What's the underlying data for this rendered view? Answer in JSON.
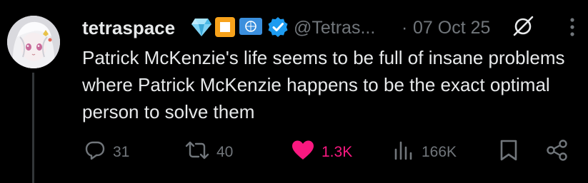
{
  "tweet": {
    "author": {
      "display_name": "tetraspace",
      "handle": "@Tetras...",
      "badges": [
        "gem-icon",
        "orange-square-icon",
        "un-flag-icon",
        "verified-icon"
      ]
    },
    "date": "07 Oct 25",
    "separator": "·",
    "text": "Patrick McKenzie's life seems to be full of insane problems where Patrick McKenzie happens to be the exact optimal person to solve them",
    "metrics": {
      "replies": "31",
      "reposts": "40",
      "likes": "1.3K",
      "views": "166K"
    },
    "liked": true
  },
  "colors": {
    "background": "#000000",
    "text": "#e7e9ea",
    "muted": "#71767b",
    "like": "#f91880",
    "verified": "#1d9bf0",
    "thread_line": "#333639"
  },
  "icons": {
    "grok": "slashed-circle-icon",
    "more": "more-vertical-icon",
    "reply": "reply-icon",
    "repost": "repost-icon",
    "like": "heart-icon",
    "views": "views-icon",
    "bookmark": "bookmark-icon",
    "share": "share-icon"
  }
}
